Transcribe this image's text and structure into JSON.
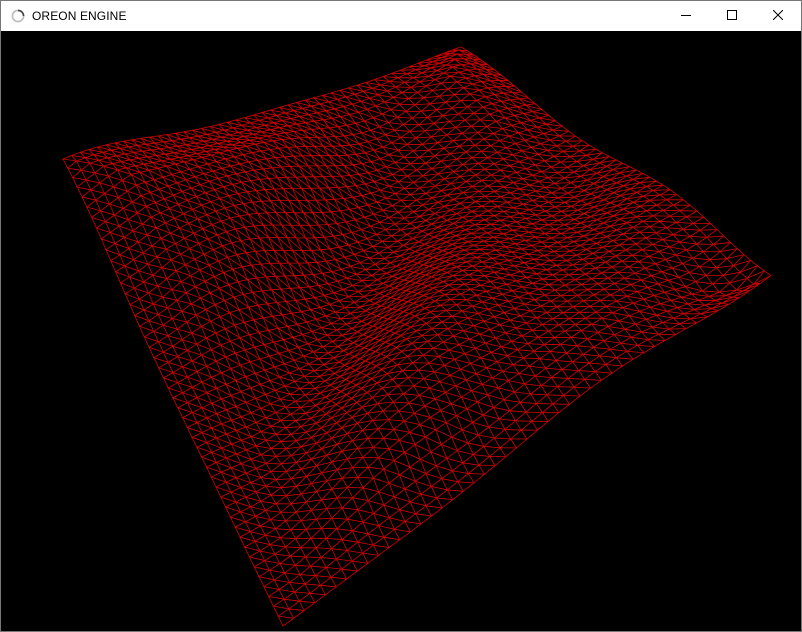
{
  "window": {
    "title": "OREON ENGINE",
    "app_icon": "spinner-icon",
    "controls": {
      "minimize_icon": "minimize-icon",
      "maximize_icon": "maximize-icon",
      "close_icon": "close-icon"
    }
  },
  "viewport": {
    "background": "#000000",
    "wire_color": "#d20000",
    "render_mode": "wireframe-terrain"
  }
}
